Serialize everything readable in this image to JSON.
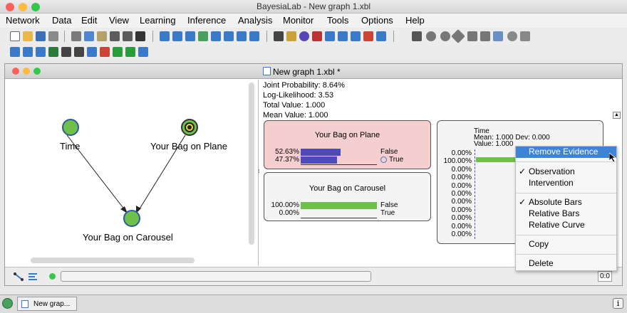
{
  "app": {
    "window_title": "BayesiaLab - New graph 1.xbl"
  },
  "colors": {
    "close": "#fc605b",
    "minimize": "#fdbc40",
    "zoom": "#34c84a",
    "accent": "#3e84d6",
    "node_fill": "#6dc04a",
    "node_border": "#2f5a9e",
    "card_pink": "#f5cfcf",
    "bar_blue": "#4e4bb8",
    "bar_green": "#6dc04a"
  },
  "menu": [
    "Network",
    "Data",
    "Edit",
    "View",
    "Learning",
    "Inference",
    "Analysis",
    "Monitor",
    "Tools",
    "Options",
    "Help"
  ],
  "inner": {
    "title": "New graph 1.xbl *"
  },
  "graph": {
    "nodes": [
      {
        "label": "Time"
      },
      {
        "label": "Your Bag on Plane"
      },
      {
        "label": "Your Bag on Carousel"
      }
    ]
  },
  "stats": {
    "joint": "Joint Probability: 8.64%",
    "loglik": "Log-Likelihood: 3.53",
    "total": "Total Value: 1.000",
    "mean": "Mean Value: 1.000"
  },
  "monitors": {
    "plane": {
      "name": "Your Bag on Plane",
      "rows": [
        {
          "pct": "52.63%",
          "state": "False",
          "value": 52.63
        },
        {
          "pct": "47.37%",
          "state": "True",
          "value": 47.37
        }
      ]
    },
    "carousel": {
      "name": "Your Bag on Carousel",
      "rows": [
        {
          "pct": "100.00%",
          "state": "False",
          "value": 100
        },
        {
          "pct": "0.00%",
          "state": "True",
          "value": 0
        }
      ]
    },
    "time": {
      "name": "Time",
      "mean": "Mean: 1.000 Dev: 0.000",
      "value": "Value: 1.000",
      "rows": [
        "0.00%",
        "100.00%",
        "0.00%",
        "0.00%",
        "0.00%",
        "0.00%",
        "0.00%",
        "0.00%",
        "0.00%",
        "0.00%",
        "0.00%"
      ]
    }
  },
  "context_menu": {
    "remove": "Remove Evidence",
    "observation": "Observation",
    "intervention": "Intervention",
    "absolute": "Absolute Bars",
    "relative": "Relative Bars",
    "relcurve": "Relative Curve",
    "copy": "Copy",
    "delete": "Delete",
    "check": "✓"
  },
  "statusbar": {
    "counter": "0:0"
  },
  "taskbar": {
    "item": "New grap..."
  }
}
